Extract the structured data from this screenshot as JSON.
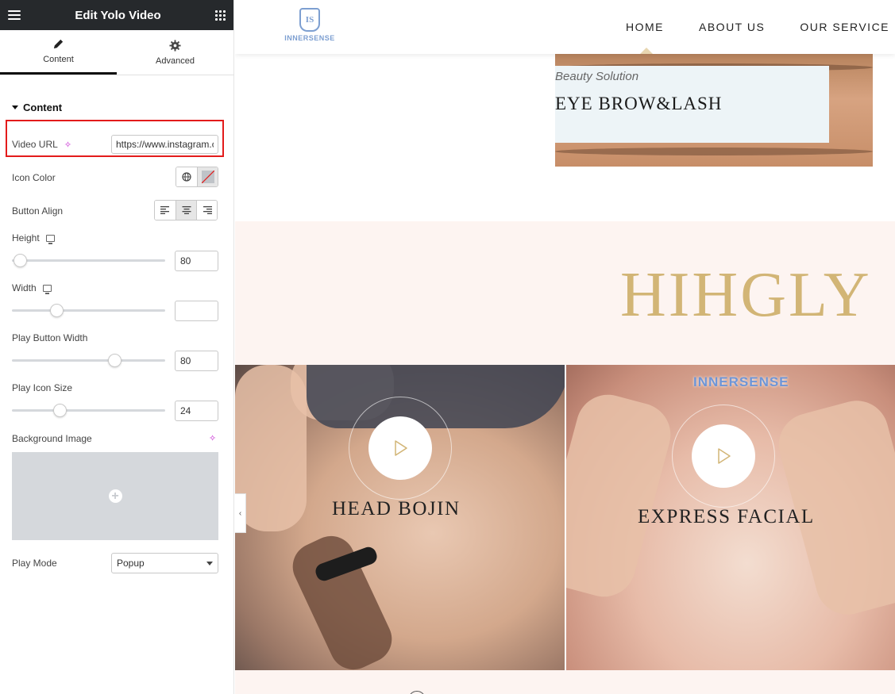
{
  "panel": {
    "title": "Edit Yolo Video",
    "tabs": [
      {
        "label": "Content",
        "icon": "pencil-icon",
        "active": true
      },
      {
        "label": "Advanced",
        "icon": "gear-icon",
        "active": false
      }
    ],
    "section_title": "Content",
    "controls": {
      "video_url": {
        "label": "Video URL",
        "value": "https://www.instagram.com/"
      },
      "icon_color": {
        "label": "Icon Color"
      },
      "button_align": {
        "label": "Button Align",
        "options": [
          "left",
          "center",
          "right"
        ],
        "selected": "center"
      },
      "height": {
        "label": "Height",
        "value": "80",
        "level": 0.05
      },
      "width": {
        "label": "Width",
        "value": "",
        "level": 0.29
      },
      "play_button_width": {
        "label": "Play Button Width",
        "value": "80",
        "level": 0.67
      },
      "play_icon_size": {
        "label": "Play Icon Size",
        "value": "24",
        "level": 0.31
      },
      "background_image": {
        "label": "Background Image"
      },
      "play_mode": {
        "label": "Play Mode",
        "value": "Popup"
      }
    }
  },
  "site": {
    "logo_text": "INNERSENSE",
    "logo_monogram": "IS",
    "nav": [
      "HOME",
      "ABOUT US",
      "OUR SERVICE"
    ],
    "active_nav": "HOME",
    "brow_card": {
      "subtitle": "Beauty Solution",
      "title": "EYE BROW&LASH"
    },
    "band_title": "HIHGLY",
    "videos": [
      {
        "title": "HEAD BOJIN"
      },
      {
        "title": "EXPRESS FACIAL",
        "watermark": "INNERSENSE"
      }
    ]
  },
  "colors": {
    "panel_header": "#26292c",
    "highlight": "#e31b1b",
    "accent_gold": "#d2b576",
    "band_bg": "#fdf4f1",
    "logo_blue": "#7d9fd1"
  }
}
